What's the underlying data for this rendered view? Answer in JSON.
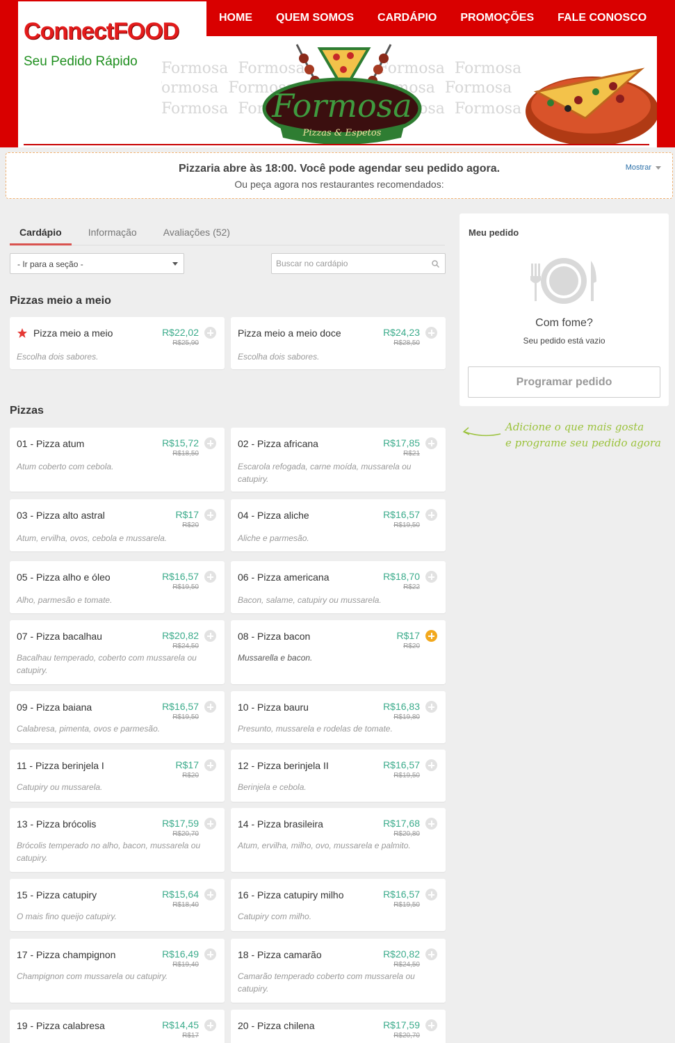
{
  "brand": {
    "title": "ConnectFOOD",
    "subtitle": "Seu Pedido Rápido"
  },
  "nav": [
    "HOME",
    "QUEM SOMOS",
    "CARDÁPIO",
    "PROMOÇÕES",
    "FALE CONOSCO"
  ],
  "banner": {
    "name": "Formosa",
    "tagline": "Pizzas & Espetos"
  },
  "notice": {
    "title": "Pizzaria abre às 18:00. Você pode agendar seu pedido agora.",
    "subtitle": "Ou peça agora nos restaurantes recomendados:",
    "toggle": "Mostrar"
  },
  "tabs": [
    "Cardápio",
    "Informação",
    "Avaliações (52)"
  ],
  "section_select": "- Ir para a seção -",
  "search_placeholder": "Buscar no cardápio",
  "categories": [
    "Pizzas meio a meio",
    "Pizzas"
  ],
  "half_items": [
    {
      "name": "Pizza meio a meio",
      "price": "R$22,02",
      "old": "R$25,90",
      "desc": "Escolha dois sabores."
    },
    {
      "name": "Pizza meio a meio doce",
      "price": "R$24,23",
      "old": "R$28,50",
      "desc": "Escolha dois sabores."
    }
  ],
  "pizzas": [
    {
      "name": "01 - Pizza atum",
      "price": "R$15,72",
      "old": "R$18,50",
      "desc": "Atum coberto com cebola."
    },
    {
      "name": "02 - Pizza africana",
      "price": "R$17,85",
      "old": "R$21",
      "desc": "Escarola refogada, carne moída, mussarela ou catupiry."
    },
    {
      "name": "03 - Pizza alto astral",
      "price": "R$17",
      "old": "R$20",
      "desc": "Atum, ervilha, ovos, cebola e mussarela."
    },
    {
      "name": "04 - Pizza aliche",
      "price": "R$16,57",
      "old": "R$19,50",
      "desc": "Aliche e parmesão."
    },
    {
      "name": "05 - Pizza alho e óleo",
      "price": "R$16,57",
      "old": "R$19,50",
      "desc": "Alho, parmesão e tomate."
    },
    {
      "name": "06 - Pizza americana",
      "price": "R$18,70",
      "old": "R$22",
      "desc": "Bacon, salame, catupiry ou mussarela."
    },
    {
      "name": "07 - Pizza bacalhau",
      "price": "R$20,82",
      "old": "R$24,50",
      "desc": "Bacalhau temperado, coberto com mussarela ou catupiry."
    },
    {
      "name": "08 - Pizza bacon",
      "price": "R$17",
      "old": "R$20",
      "desc": "Mussarella e bacon."
    },
    {
      "name": "09 - Pizza baiana",
      "price": "R$16,57",
      "old": "R$19,50",
      "desc": "Calabresa, pimenta, ovos e parmesão."
    },
    {
      "name": "10 - Pizza bauru",
      "price": "R$16,83",
      "old": "R$19,80",
      "desc": "Presunto, mussarela e rodelas de tomate."
    },
    {
      "name": "11 - Pizza berinjela I",
      "price": "R$17",
      "old": "R$20",
      "desc": "Catupiry ou mussarela."
    },
    {
      "name": "12 - Pizza berinjela II",
      "price": "R$16,57",
      "old": "R$19,50",
      "desc": "Berinjela e cebola."
    },
    {
      "name": "13 - Pizza brócolis",
      "price": "R$17,59",
      "old": "R$20,70",
      "desc": "Brócolis temperado no alho, bacon, mussarela ou catupiry."
    },
    {
      "name": "14 - Pizza brasileira",
      "price": "R$17,68",
      "old": "R$20,80",
      "desc": "Atum, ervilha, milho, ovo, mussarela e palmito."
    },
    {
      "name": "15 - Pizza catupiry",
      "price": "R$15,64",
      "old": "R$18,40",
      "desc": "O mais fino queijo catupiry."
    },
    {
      "name": "16 - Pizza catupiry milho",
      "price": "R$16,57",
      "old": "R$19,50",
      "desc": "Catupiry com milho."
    },
    {
      "name": "17 - Pizza champignon",
      "price": "R$16,49",
      "old": "R$19,40",
      "desc": "Champignon com mussarela ou catupiry."
    },
    {
      "name": "18 - Pizza camarão",
      "price": "R$20,82",
      "old": "R$24,50",
      "desc": "Camarão temperado coberto com mussarela ou catupiry."
    },
    {
      "name": "19 - Pizza calabresa",
      "price": "R$14,45",
      "old": "R$17",
      "desc": ""
    },
    {
      "name": "20 - Pizza chilena",
      "price": "R$17,59",
      "old": "R$20,70",
      "desc": ""
    }
  ],
  "order": {
    "title": "Meu pedido",
    "hungry": "Com fome?",
    "empty": "Seu pedido está vazio",
    "button": "Programar pedido",
    "hint_line1": "Adicione o que mais gosta",
    "hint_line2": "e programe seu pedido agora"
  },
  "colors": {
    "brand_red": "#d90000",
    "price_green": "#3bab8b",
    "hint_green": "#9bc23c",
    "accent_orange": "#f2a81d"
  }
}
